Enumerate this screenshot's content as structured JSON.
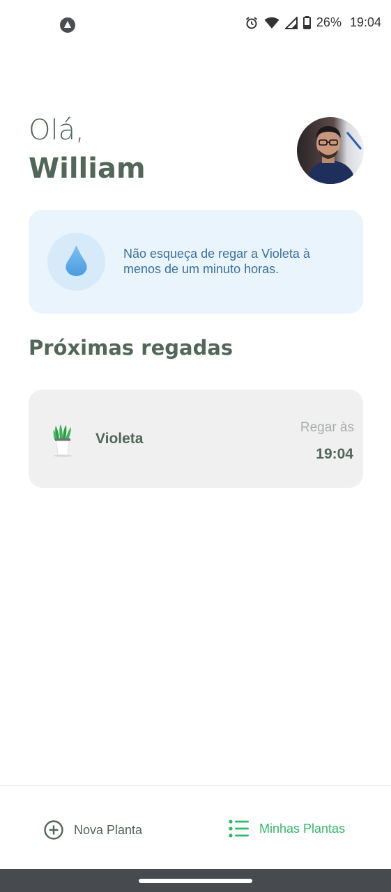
{
  "status_bar": {
    "battery_text": "26%",
    "time": "19:04",
    "icons": [
      "app-notification-icon",
      "alarm-icon",
      "wifi-icon",
      "signal-icon",
      "battery-icon"
    ]
  },
  "header": {
    "greeting": "Olá,",
    "username": "William"
  },
  "tip": {
    "icon": "water-drop-icon",
    "text": "Não esqueça de regar a Violeta à menos de um minuto horas."
  },
  "section": {
    "title": "Próximas regadas"
  },
  "plants": [
    {
      "name": "Violeta",
      "water_label": "Regar às",
      "water_time": "19:04",
      "icon": "potted-plant-icon"
    }
  ],
  "tab_bar": {
    "tabs": [
      {
        "label": "Nova Planta",
        "icon": "add-circle-icon",
        "active": false
      },
      {
        "label": "Minhas Plantas",
        "icon": "list-icon",
        "active": true
      }
    ]
  },
  "colors": {
    "heading": "#52665A",
    "accent_green": "#32B768",
    "tip_background": "#EAF4FD",
    "tip_text": "#3D7199",
    "card_background": "#F0F0F0",
    "nav_bar": "#474B4F"
  }
}
